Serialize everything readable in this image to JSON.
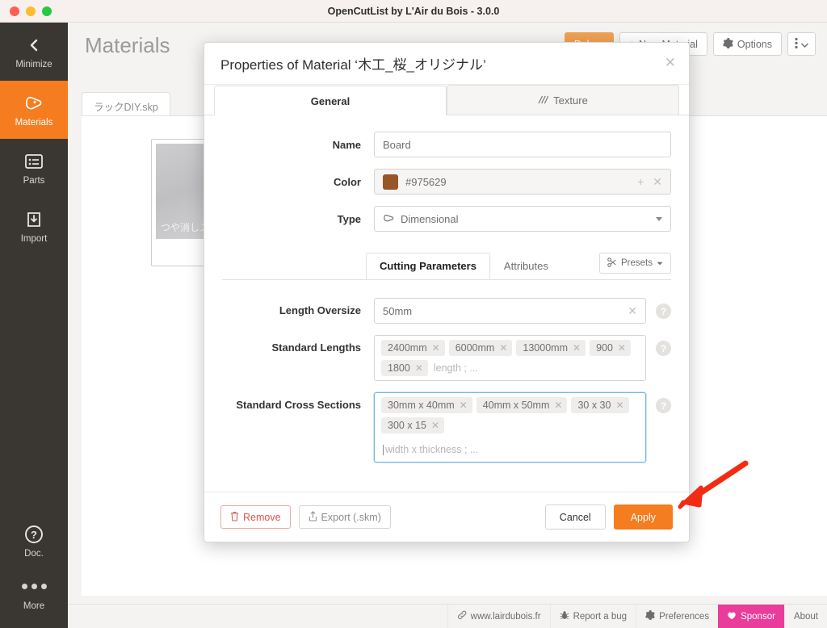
{
  "window": {
    "title": "OpenCutList by L'Air du Bois - 3.0.0"
  },
  "sidebar": {
    "items": [
      {
        "label": "Minimize",
        "icon": "chevron-left-icon",
        "active": false
      },
      {
        "label": "Materials",
        "icon": "materials-icon",
        "active": true
      },
      {
        "label": "Parts",
        "icon": "list-icon",
        "active": false
      },
      {
        "label": "Import",
        "icon": "import-icon",
        "active": false
      }
    ],
    "bottom": [
      {
        "label": "Doc.",
        "icon": "question-circle-icon"
      },
      {
        "label": "More",
        "icon": "ellipsis-icon"
      }
    ]
  },
  "page": {
    "title": "Materials",
    "actions": {
      "debug_label": "Debug",
      "new_material_label": "New Material",
      "options_label": "Options",
      "kebab_label": ""
    },
    "file_tab": "ラックDIY.skp",
    "material_card": {
      "name": "つや消しステンレス",
      "badge": "?",
      "texture_icon": "texture-icon",
      "edit_icon": "pencil-icon"
    }
  },
  "statusbar": {
    "items": [
      {
        "label": "www.lairdubois.fr",
        "icon": "link-icon",
        "highlight": false
      },
      {
        "label": "Report a bug",
        "icon": "bug-icon",
        "highlight": false
      },
      {
        "label": "Preferences",
        "icon": "gear-icon",
        "highlight": false
      },
      {
        "label": "Sponsor",
        "icon": "heart-icon",
        "highlight": true
      },
      {
        "label": "About",
        "icon": "",
        "highlight": false
      }
    ],
    "sponsor_color": "#ea3c9b"
  },
  "modal": {
    "title": "Properties of Material ‘木工_桜_オリジナル’",
    "close_icon": "close-icon",
    "tabs": [
      {
        "label": "General",
        "icon": "",
        "active": true
      },
      {
        "label": "Texture",
        "icon": "texture-icon",
        "active": false
      }
    ],
    "general": {
      "name_label": "Name",
      "name_value": "Board",
      "color_label": "Color",
      "color_value": "#975629",
      "color_swatch": "#975629",
      "color_add_icon": "plus-icon",
      "color_clear_icon": "close-icon",
      "type_label": "Type",
      "type_value": "Dimensional",
      "type_icon": "board-icon"
    },
    "sub_tabs": [
      {
        "label": "Cutting Parameters",
        "active": true
      },
      {
        "label": "Attributes",
        "active": false
      }
    ],
    "presets_label": "Presets",
    "presets_icon": "presets-icon",
    "params": {
      "length_oversize": {
        "label": "Length Oversize",
        "value": "50mm",
        "clear_icon": "close-icon",
        "help_icon": "help-icon"
      },
      "standard_lengths": {
        "label": "Standard Lengths",
        "tags": [
          "2400mm",
          "6000mm",
          "13000mm",
          "900",
          "1800"
        ],
        "placeholder": "length ; ...",
        "help_icon": "help-icon"
      },
      "standard_cross_sections": {
        "label": "Standard Cross Sections",
        "tags": [
          "30mm x 40mm",
          "40mm x 50mm",
          "30 x 30",
          "300 x 15"
        ],
        "placeholder": "width x thickness ; ...",
        "help_icon": "help-icon",
        "focused": true
      }
    },
    "footer": {
      "remove_label": "Remove",
      "remove_icon": "trash-icon",
      "export_label": "Export (.skm)",
      "export_icon": "export-icon",
      "cancel_label": "Cancel",
      "apply_label": "Apply",
      "apply_color": "#f57c1f"
    }
  },
  "annotation": {
    "arrow_color": "#f22c13",
    "points_to": "Apply"
  }
}
